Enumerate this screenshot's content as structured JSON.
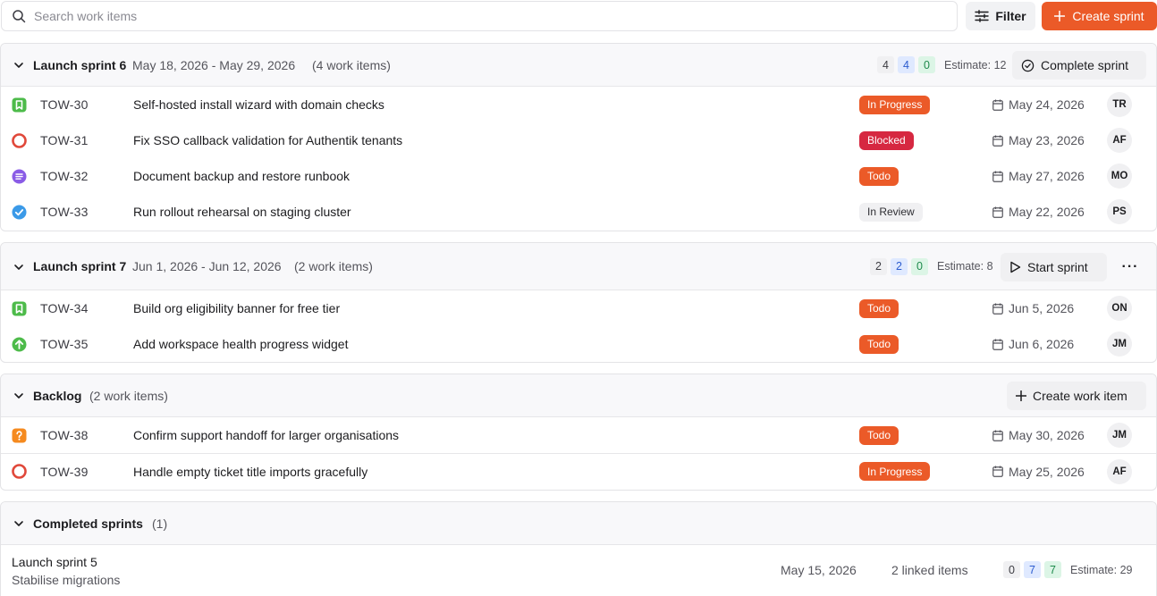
{
  "search": {
    "placeholder": "Search work items"
  },
  "toolbar": {
    "filter_label": "Filter",
    "create_sprint_label": "Create sprint"
  },
  "colors": {
    "accent": "#eb5a28",
    "blocked": "#d62841",
    "counter_blue": "#2c5ccf",
    "counter_green": "#1e8a4c"
  },
  "sprints": [
    {
      "title": "Launch sprint 6",
      "dates": "May 18, 2026 - May 29, 2026",
      "count": "(4 work items)",
      "counters": {
        "todo": "4",
        "in_progress": "4",
        "done": "0"
      },
      "estimate": "Estimate: 12",
      "action_label": "Complete sprint",
      "items": [
        {
          "icon": "bookmark-icon",
          "key": "TOW-30",
          "title": "Self-hosted install wizard with domain checks",
          "status": "In Progress",
          "date": "May 24, 2026",
          "assignee": "TR"
        },
        {
          "icon": "blocked-circle-icon",
          "key": "TOW-31",
          "title": "Fix SSO callback validation for Authentik tenants",
          "status": "Blocked",
          "date": "May 23, 2026",
          "assignee": "AF"
        },
        {
          "icon": "document-icon",
          "key": "TOW-32",
          "title": "Document backup and restore runbook",
          "status": "Todo",
          "date": "May 27, 2026",
          "assignee": "MO"
        },
        {
          "icon": "checkbox-icon",
          "key": "TOW-33",
          "title": "Run rollout rehearsal on staging cluster",
          "status": "In Review",
          "date": "May 22, 2026",
          "assignee": "PS"
        }
      ]
    },
    {
      "title": "Launch sprint 7",
      "dates": "Jun 1, 2026 - Jun 12, 2026",
      "count": "(2 work items)",
      "counters": {
        "todo": "2",
        "in_progress": "2",
        "done": "0"
      },
      "estimate": "Estimate: 8",
      "action_label": "Start sprint",
      "more_label": "···",
      "items": [
        {
          "icon": "bookmark-icon",
          "key": "TOW-34",
          "title": "Build org eligibility banner for free tier",
          "status": "Todo",
          "date": "Jun 5, 2026",
          "assignee": "ON"
        },
        {
          "icon": "arrow-up-icon",
          "key": "TOW-35",
          "title": "Add workspace health progress widget",
          "status": "Todo",
          "date": "Jun 6, 2026",
          "assignee": "JM"
        }
      ]
    }
  ],
  "backlog": {
    "title": "Backlog",
    "count": "(2 work items)",
    "action_label": "Create work item",
    "items": [
      {
        "icon": "question-icon",
        "key": "TOW-38",
        "title": "Confirm support handoff for larger organisations",
        "status": "Todo",
        "date": "May 30, 2026",
        "assignee": "JM"
      },
      {
        "icon": "blocked-circle-icon",
        "key": "TOW-39",
        "title": "Handle empty ticket title imports gracefully",
        "status": "In Progress",
        "date": "May 25, 2026",
        "assignee": "AF"
      }
    ]
  },
  "completed": {
    "title": "Completed sprints",
    "count": "(1)",
    "sprints": [
      {
        "name": "Launch sprint 5",
        "goal": "Stabilise migrations",
        "date": "May 15, 2026",
        "linked": "2 linked items",
        "counters": {
          "todo": "0",
          "in_progress": "7",
          "done": "7"
        },
        "estimate": "Estimate: 29"
      }
    ]
  }
}
